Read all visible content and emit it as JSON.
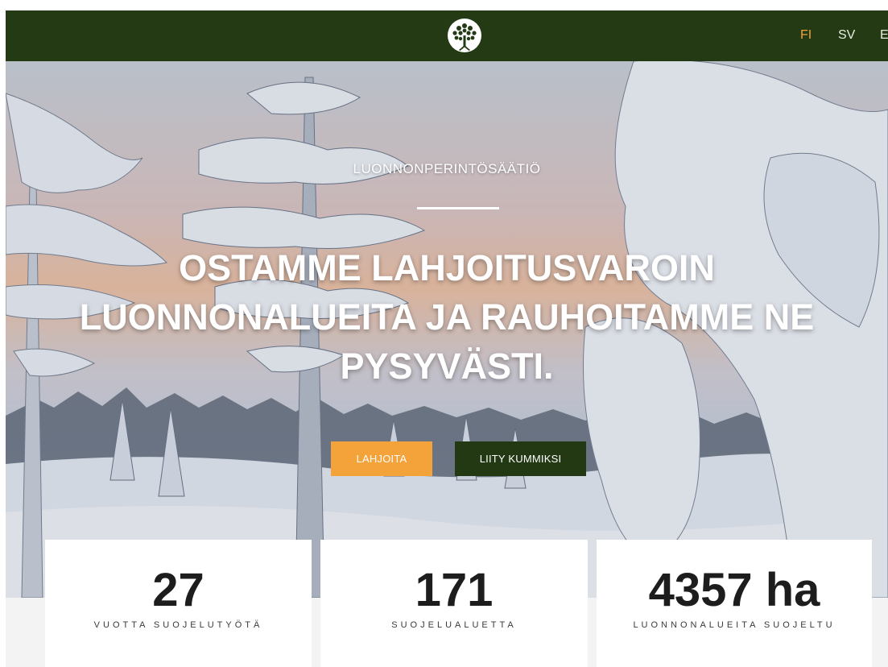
{
  "header": {
    "languages": [
      {
        "label": "FI",
        "active": true
      },
      {
        "label": "SV",
        "active": false
      },
      {
        "label": "E",
        "active": false
      }
    ],
    "logo_icon": "tree-logo-icon"
  },
  "hero": {
    "kicker": "LUONNONPERINTÖSÄÄTIÖ",
    "headline_lines": [
      "OSTAMME LAHJOITUSVAROIN",
      "LUONNONALUEITA JA RAUHOITAMME NE",
      "PYSYVÄSTI."
    ],
    "buttons": {
      "donate": "LAHJOITA",
      "join": "LIITY KUMMIKSI"
    }
  },
  "stats": [
    {
      "value": "27",
      "label": "VUOTTA SUOJELUTYÖTÄ"
    },
    {
      "value": "171",
      "label": "SUOJELUALUETTA"
    },
    {
      "value": "4357 ha",
      "label": "LUONNONALUEITA SUOJELTU"
    }
  ],
  "colors": {
    "nav_bg": "#233a15",
    "accent_orange": "#f4a23a",
    "dark_green_button": "#223913"
  }
}
